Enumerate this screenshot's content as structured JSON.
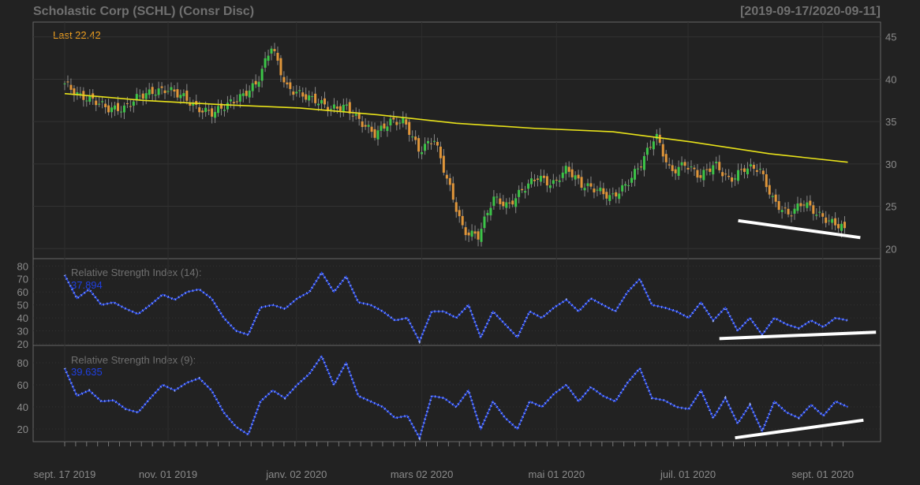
{
  "header": {
    "title": "Scholastic Corp  (SCHL) (Consr Disc)",
    "range": "[2019-09-17/2020-09-11]",
    "last": "Last 22.42"
  },
  "colors": {
    "up": "#3cc448",
    "down": "#e0963a",
    "sma": "#e8e21a",
    "rsi": "#1f3fe0",
    "bg": "#222222"
  },
  "chart_data": [
    {
      "type": "candlestick",
      "title": "Scholastic Corp (SCHL)",
      "ylim": [
        19,
        46
      ],
      "yticks": [
        20,
        25,
        30,
        35,
        40,
        45
      ],
      "xlim": [
        0,
        250
      ],
      "xticks": [
        {
          "i": 0,
          "label": "sept. 17 2019"
        },
        {
          "i": 33,
          "label": "nov. 01 2019"
        },
        {
          "i": 74,
          "label": "janv. 02 2020"
        },
        {
          "i": 114,
          "label": "mars 02 2020"
        },
        {
          "i": 157,
          "label": "mai 01 2020"
        },
        {
          "i": 199,
          "label": "juil. 01 2020"
        },
        {
          "i": 242,
          "label": "sept. 01 2020"
        }
      ],
      "closes": [
        39.5,
        38,
        37.5,
        36.5,
        36.5,
        38,
        38.5,
        38.8,
        38,
        36.5,
        36,
        37,
        38,
        39.5,
        44,
        39,
        38.2,
        37.5,
        36.5,
        36.8,
        35,
        33.5,
        35,
        35,
        31.5,
        33,
        27.5,
        22,
        21.5,
        26,
        25,
        27,
        28.5,
        27.5,
        29.5,
        27.5,
        27,
        26,
        27.5,
        30,
        33.5,
        29,
        30,
        28.5,
        30,
        28,
        29.5,
        29.5,
        25.5,
        24,
        25.5,
        24,
        23,
        22.42
      ],
      "sma": [
        38.3,
        37.5,
        37,
        36.6,
        35.8,
        34.8,
        34.2,
        33.8,
        32.6,
        31.2,
        30.2
      ],
      "trendline": {
        "from": [
          215,
          23.3
        ],
        "to": [
          254,
          21.3
        ]
      }
    },
    {
      "type": "line",
      "title": "Relative Strength Index (14):",
      "value": "37.894",
      "ylim": [
        20,
        82
      ],
      "yticks": [
        20,
        30,
        40,
        50,
        60,
        70,
        80
      ],
      "values": [
        73,
        55,
        62,
        50,
        52,
        47,
        43,
        50,
        58,
        54,
        60,
        62,
        55,
        40,
        30,
        27,
        48,
        50,
        47,
        55,
        60,
        75,
        60,
        72,
        52,
        50,
        45,
        38,
        40,
        22,
        45,
        45,
        40,
        50,
        25,
        45,
        35,
        25,
        45,
        40,
        48,
        54,
        45,
        55,
        50,
        45,
        60,
        70,
        50,
        48,
        45,
        40,
        52,
        38,
        48,
        30,
        40,
        27,
        40,
        35,
        32,
        38,
        33,
        40,
        38
      ],
      "trendline": {
        "from": [
          209,
          24
        ],
        "to": [
          259,
          29
        ]
      }
    },
    {
      "type": "line",
      "title": "Relative Strength Index (9):",
      "value": "39.635",
      "ylim": [
        10,
        90
      ],
      "yticks": [
        20,
        40,
        60,
        80
      ],
      "values": [
        75,
        50,
        55,
        45,
        46,
        38,
        35,
        48,
        60,
        55,
        62,
        66,
        55,
        35,
        22,
        15,
        45,
        55,
        48,
        60,
        70,
        86,
        60,
        80,
        50,
        45,
        40,
        30,
        32,
        12,
        50,
        48,
        40,
        55,
        20,
        45,
        30,
        20,
        45,
        40,
        52,
        60,
        45,
        58,
        50,
        45,
        62,
        75,
        48,
        46,
        40,
        38,
        55,
        30,
        48,
        25,
        42,
        18,
        45,
        35,
        30,
        42,
        32,
        45,
        40
      ],
      "trendline": {
        "from": [
          214,
          12
        ],
        "to": [
          255,
          28
        ]
      }
    }
  ]
}
